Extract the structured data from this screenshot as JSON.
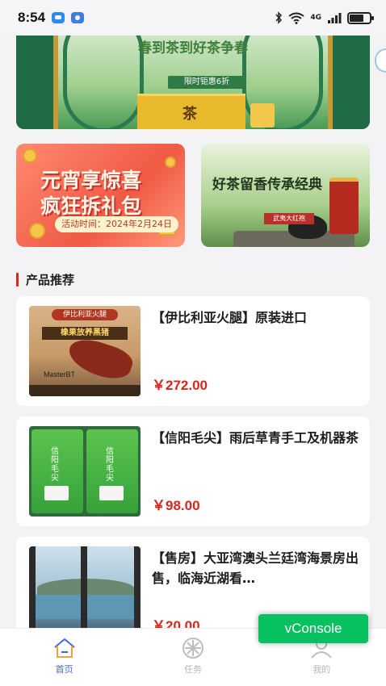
{
  "status_bar": {
    "time": "8:54",
    "network": "4G",
    "battery_level": 0.7
  },
  "top_banner": {
    "title": "春到茶到好茶争春",
    "badge": "限时钜惠6折",
    "box_label": "茶"
  },
  "promos": {
    "red": {
      "line1": "元宵享惊喜",
      "line2": "疯狂拆礼包",
      "date": "活动时间：2024年2月24日"
    },
    "green": {
      "slogan": "好茶留香传承经典",
      "stamp": "武夷大红袍"
    }
  },
  "section": {
    "title": "产品推荐"
  },
  "products": [
    {
      "title": "【伊比利亚火腿】原装进口",
      "price": "￥272.00",
      "thumb_cap": "伊比利亚火腿",
      "thumb_head": "橡果放养黑猪",
      "thumb_brand": "MasterBT"
    },
    {
      "title": "【信阳毛尖】雨后草青手工及机器茶",
      "price": "￥98.00",
      "thumb_label": "信阳毛尖"
    },
    {
      "title": "【售房】大亚湾澳头兰廷湾海景房出售，临海近湖看…",
      "price": "￥20.00"
    }
  ],
  "bottom_nav": {
    "items": [
      {
        "label": "首页",
        "icon": "home-icon",
        "active": true
      },
      {
        "label": "任务",
        "icon": "task-icon",
        "active": false
      },
      {
        "label": "我的",
        "icon": "profile-icon",
        "active": false
      }
    ]
  },
  "vconsole": {
    "label": "vConsole",
    "color": "#07c160"
  },
  "colors": {
    "accent_red": "#d8261c",
    "active_nav": "#3d6bd8",
    "inactive_nav": "#b5b5b5"
  }
}
